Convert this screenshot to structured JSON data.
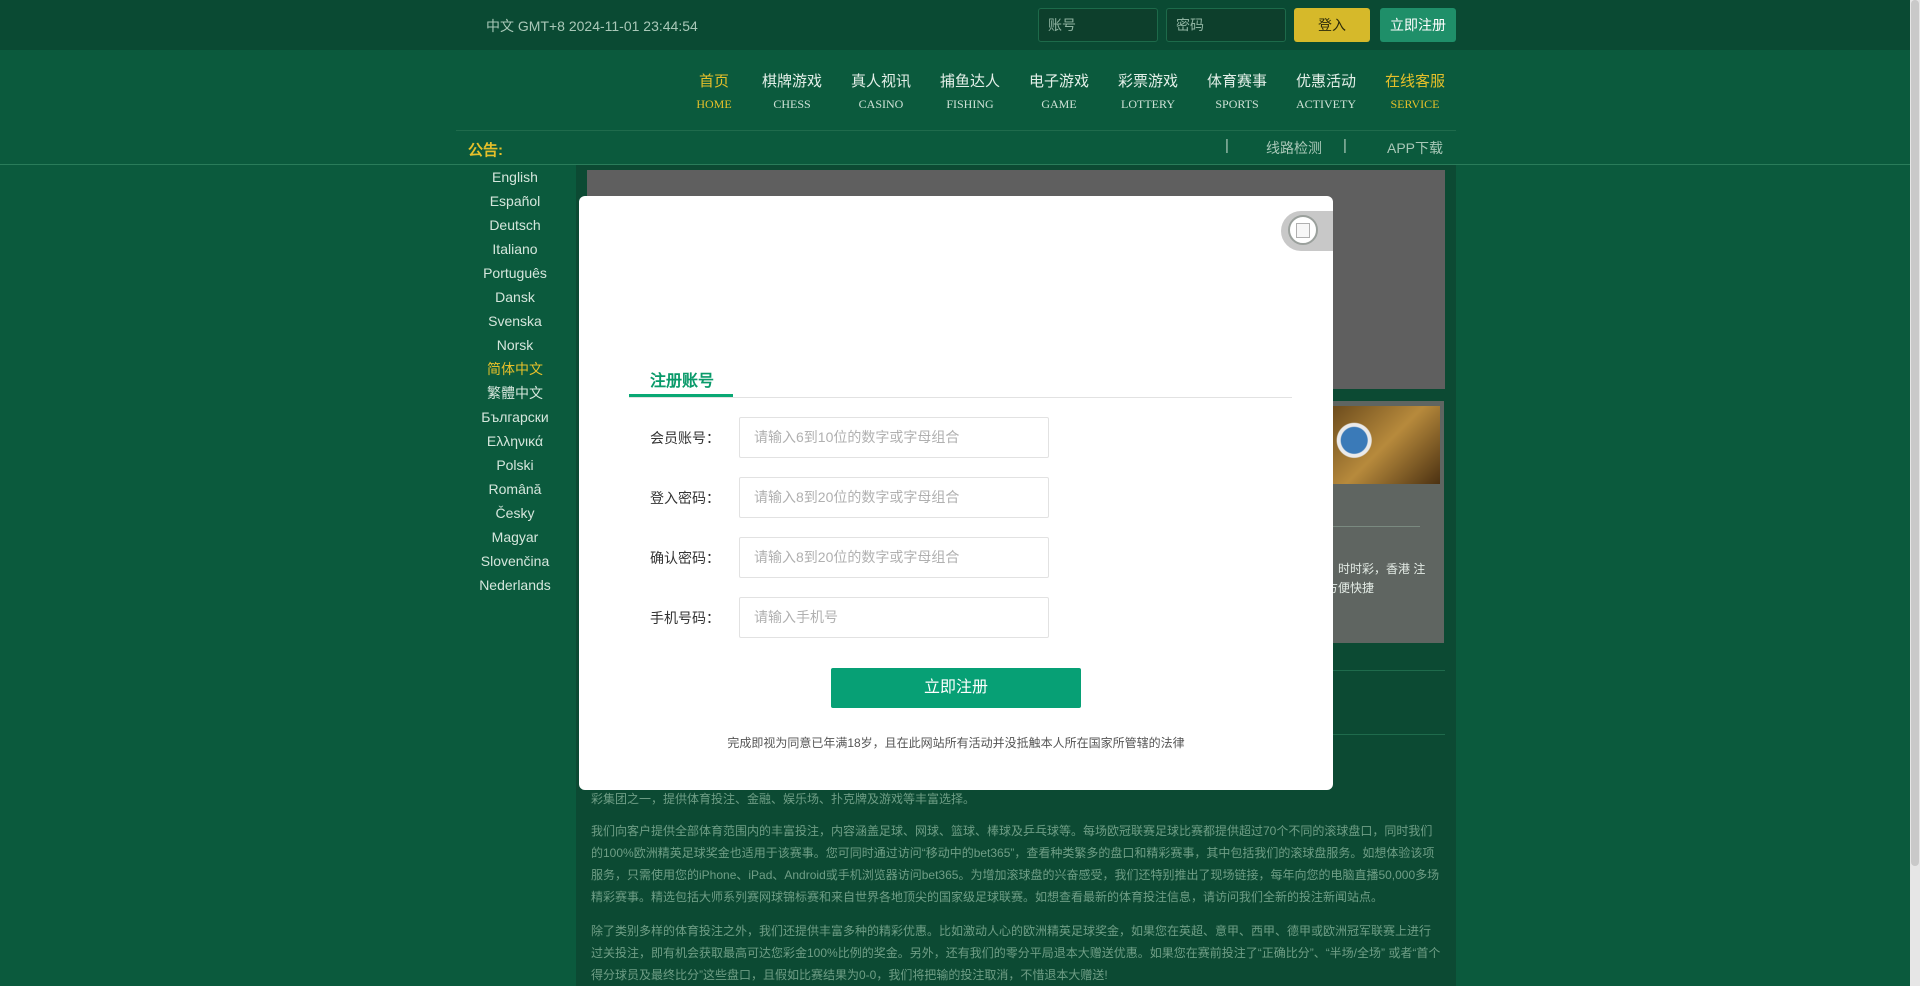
{
  "topbar": {
    "datetime": "中文 GMT+8 2024-11-01 23:44:54",
    "account_placeholder": "账号",
    "password_placeholder": "密码",
    "login_label": "登入",
    "register_label": "立即注册"
  },
  "nav": [
    {
      "zh": "首页",
      "en": "HOME",
      "active": true
    },
    {
      "zh": "棋牌游戏",
      "en": "CHESS"
    },
    {
      "zh": "真人视讯",
      "en": "CASINO"
    },
    {
      "zh": "捕鱼达人",
      "en": "FISHING"
    },
    {
      "zh": "电子游戏",
      "en": "GAME"
    },
    {
      "zh": "彩票游戏",
      "en": "LOTTERY"
    },
    {
      "zh": "体育赛事",
      "en": "SPORTS"
    },
    {
      "zh": "优惠活动",
      "en": "ACTIVETY"
    },
    {
      "zh": "在线客服",
      "en": "SERVICE",
      "active": true
    }
  ],
  "notice": {
    "label": "公告:",
    "separator": "|",
    "line_check": "线路检测",
    "app_download": "APP下载"
  },
  "languages": [
    "English",
    "Español",
    "Deutsch",
    "Italiano",
    "Português",
    "Dansk",
    "Svenska",
    "Norsk",
    "简体中文",
    "繁體中文",
    "Български",
    "Ελληνικά",
    "Polski",
    "Română",
    "Česky",
    "Magyar",
    "Slovenčina",
    "Nederlands"
  ],
  "active_language": "简体中文",
  "card": {
    "text": "：时时彩，香港 注方便快捷"
  },
  "paragraphs": [
    "彩集团之一，提供体育投注、金融、娱乐场、扑克牌及游戏等丰富选择。",
    "我们向客户提供全部体育范围内的丰富投注，内容涵盖足球、网球、篮球、棒球及乒乓球等。每场欧冠联赛足球比赛都提供超过70个不同的滚球盘口，同时我们的100%欧洲精英足球奖金也适用于该赛事。您可同时通过访问“移动中的bet365”，查看种类繁多的盘口和精彩赛事，其中包括我们的滚球盘服务。如想体验该项服务，只需使用您的iPhone、iPad、Android或手机浏览器访问bet365。为增加滚球盘的兴奋感受，我们还特别推出了现场链接，每年向您的电脑直播50,000多场精彩赛事。精选包括大师系列赛网球锦标赛和来自世界各地顶尖的国家级足球联赛。如想查看最新的体育投注信息，请访问我们全新的投注新闻站点。",
    "除了类别多样的体育投注之外，我们还提供丰富多种的精彩优惠。比如激动人心的欧洲精英足球奖金，如果您在英超、意甲、西甲、德甲或欧洲冠军联赛上进行过关投注，即有机会获取最高可达您彩金100%比例的奖金。另外，还有我们的零分平局退本大赠送优惠。如果您在赛前投注了“正确比分”、“半场/全场” 或者“首个得分球员及最终比分”这些盘口，且假如比赛结果为0-0，我们将把输的投注取消，不惜退本大赠送!"
  ],
  "modal": {
    "tab_title": "注册账号",
    "fields": [
      {
        "label": "会员账号：",
        "placeholder": "请输入6到10位的数字或字母组合"
      },
      {
        "label": "登入密码：",
        "placeholder": "请输入8到20位的数字或字母组合"
      },
      {
        "label": "确认密码：",
        "placeholder": "请输入8到20位的数字或字母组合"
      },
      {
        "label": "手机号码：",
        "placeholder": "请输入手机号"
      }
    ],
    "submit_label": "立即注册",
    "terms": "完成即视为同意已年满18岁，且在此网站所有活动并没抵触本人所在国家所管辖的法律"
  },
  "colors": {
    "page_bg": "#0b5a3d",
    "accent_gold": "#e6c02a",
    "modal_green": "#07a075"
  }
}
